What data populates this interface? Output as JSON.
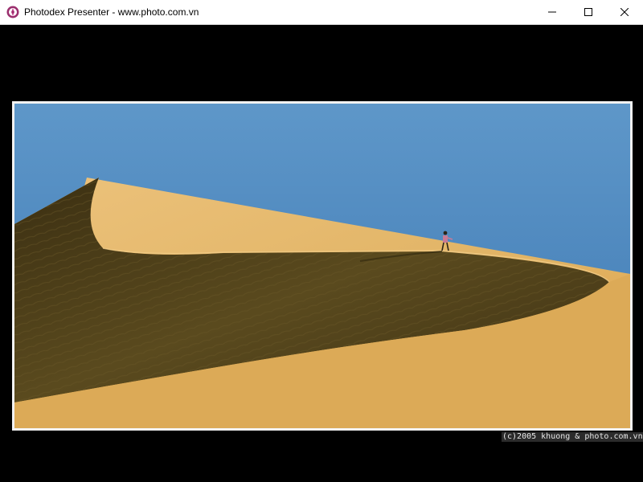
{
  "window": {
    "title": "Photodex Presenter - www.photo.com.vn",
    "icons": {
      "app": "photodex-app-icon",
      "minimize": "minimize-icon",
      "maximize": "maximize-icon",
      "close": "close-icon"
    }
  },
  "photo": {
    "subject": "sand-dune-photo",
    "caption": "(c)2005 khuong & photo.com.vn"
  },
  "colors": {
    "background": "#000000",
    "sky": "#5b93c7",
    "sand_light": "#e3b76a",
    "sand_shadow": "#4a3c1a",
    "frame": "#f2f2f2"
  }
}
